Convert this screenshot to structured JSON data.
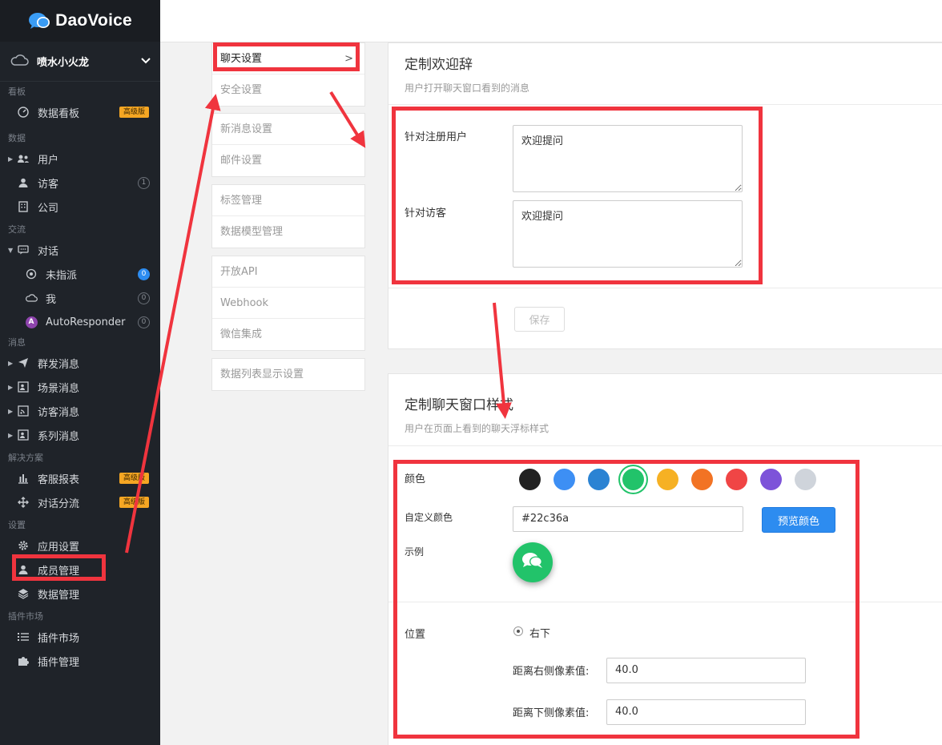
{
  "app": {
    "brand": "DaoVoice"
  },
  "sidebar": {
    "team_name": "喷水小火龙",
    "sections": {
      "kanban": "看板",
      "data": "数据",
      "comm": "交流",
      "message": "消息",
      "solution": "解决方案",
      "settings": "设置",
      "plugin": "插件市场"
    },
    "items": {
      "dashboard": "数据看板",
      "users": "用户",
      "visitors": "访客",
      "company": "公司",
      "conversations": "对话",
      "unassigned": "未指派",
      "me": "我",
      "autoresponder": "AutoResponder",
      "broadcast": "群发消息",
      "scene": "场景消息",
      "visitor_msg": "访客消息",
      "series": "系列消息",
      "report": "客服报表",
      "routing": "对话分流",
      "app_settings": "应用设置",
      "members": "成员管理",
      "data_mgmt": "数据管理",
      "plugin_market": "插件市场",
      "plugin_mgmt": "插件管理"
    },
    "pro_badge": "高级版",
    "counts": {
      "visitors": "1",
      "unassigned": "0",
      "me": "0",
      "autoresponder": "0"
    },
    "autoresponder_avatar": "A"
  },
  "settings_menu": {
    "chat": "聊天设置",
    "security": "安全设置",
    "new_message": "新消息设置",
    "email": "邮件设置",
    "tags": "标签管理",
    "data_model": "数据模型管理",
    "open_api": "开放API",
    "webhook": "Webhook",
    "wechat": "微信集成",
    "list_display": "数据列表显示设置"
  },
  "welcome": {
    "title": "定制欢迎辞",
    "subtitle": "用户打开聊天窗口看到的消息",
    "registered_label": "针对注册用户",
    "registered_value": "欢迎提问",
    "visitor_label": "针对访客",
    "visitor_value": "欢迎提问",
    "save": "保存"
  },
  "style": {
    "title": "定制聊天窗口样式",
    "subtitle": "用户在页面上看到的聊天浮标样式",
    "color_label": "颜色",
    "swatches": [
      "#222222",
      "#3d8ff4",
      "#2b83d3",
      "#22c36a",
      "#f6b124",
      "#f27324",
      "#f04545",
      "#7d53d9",
      "#cfd4db"
    ],
    "selected_swatch": "#22c36a",
    "custom_color_label": "自定义颜色",
    "custom_color_value": "#22c36a",
    "preview_button": "预览颜色",
    "example_label": "示例",
    "position_label": "位置",
    "position_option": "右下",
    "right_offset_label": "距离右侧像素值:",
    "right_offset_value": "40.0",
    "bottom_offset_label": "距离下侧像素值:",
    "bottom_offset_value": "40.0"
  }
}
